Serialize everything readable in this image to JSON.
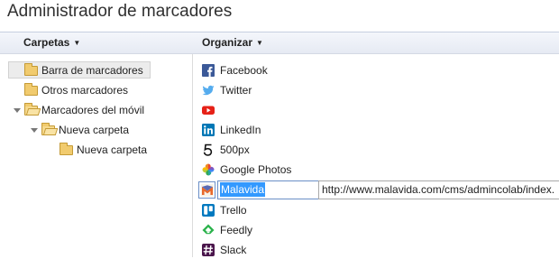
{
  "window": {
    "title": "Administrador de marcadores"
  },
  "toolbar": {
    "folders_label": "Carpetas",
    "organize_label": "Organizar"
  },
  "tree": [
    {
      "label": "Barra de marcadores",
      "selected": true
    },
    {
      "label": "Otros marcadores"
    },
    {
      "label": "Marcadores del móvil",
      "expanded": true
    },
    {
      "label": "Nueva carpeta",
      "expanded": true
    },
    {
      "label": "Nueva carpeta"
    }
  ],
  "bookmarks": [
    {
      "label": "Facebook",
      "icon": "facebook-icon"
    },
    {
      "label": "Twitter",
      "icon": "twitter-icon"
    },
    {
      "label": "",
      "icon": "youtube-icon"
    },
    {
      "label": "LinkedIn",
      "icon": "linkedin-icon"
    },
    {
      "label": "500px",
      "icon": "500px-icon"
    },
    {
      "label": "Google Photos",
      "icon": "google-photos-icon"
    },
    {
      "label": "Trello",
      "icon": "trello-icon"
    },
    {
      "label": "Feedly",
      "icon": "feedly-icon"
    },
    {
      "label": "Slack",
      "icon": "slack-icon"
    }
  ],
  "editing": {
    "name_value": "Malavida",
    "url_value": "http://www.malavida.com/cms/admincolab/index.",
    "icon": "malavida-icon"
  },
  "colors": {
    "toolbar_bg": "#e6eaf3",
    "selection": "#3399ff",
    "facebook": "#3b5998",
    "twitter": "#55acee",
    "youtube": "#e62117",
    "linkedin": "#0077b5",
    "trello": "#0079bf",
    "feedly": "#2bb24c",
    "slack": "#4a154b"
  }
}
